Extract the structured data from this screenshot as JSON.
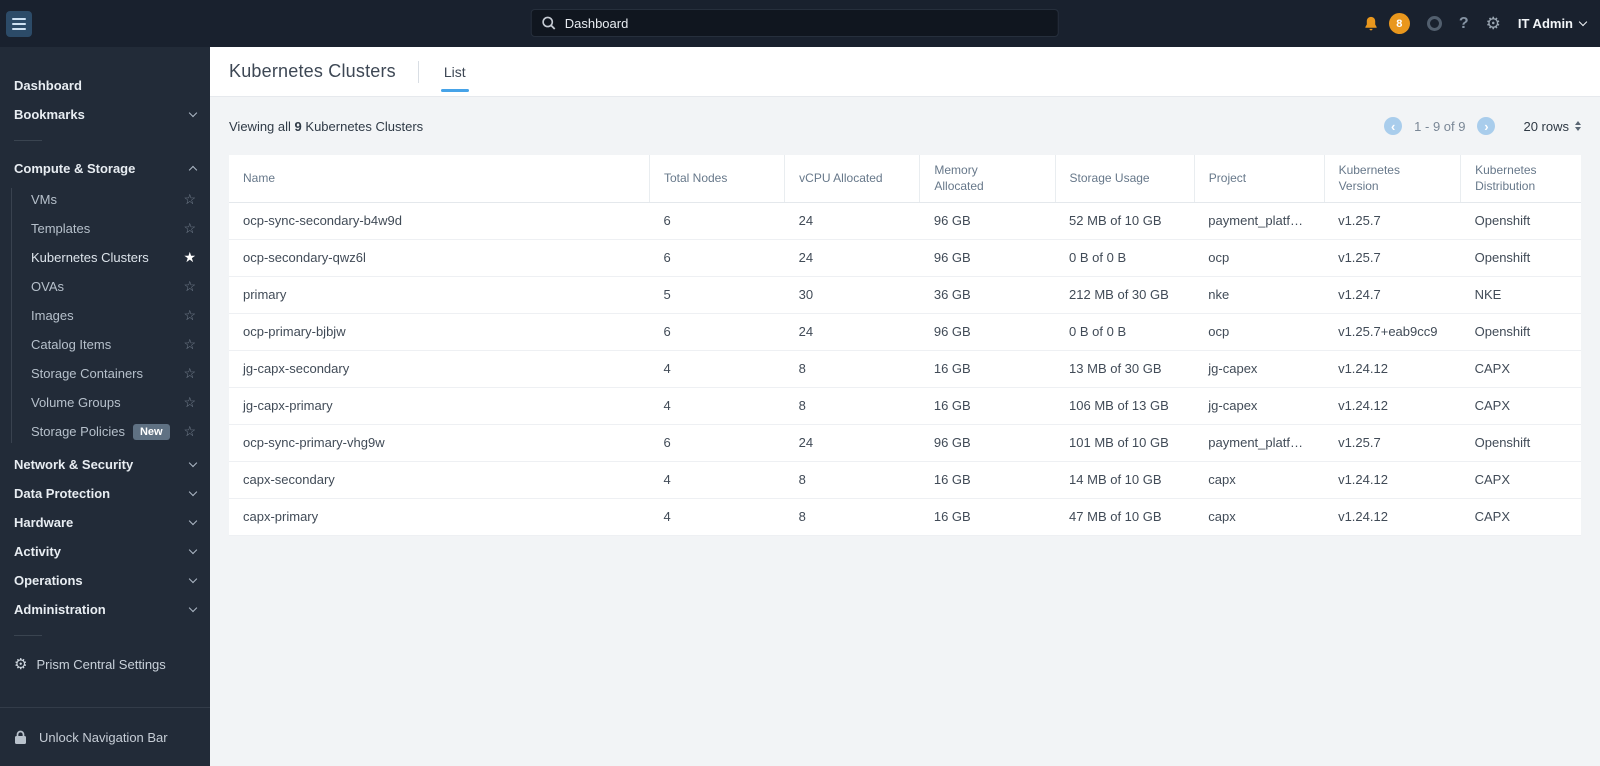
{
  "colors": {
    "accent": "#46a3e8",
    "notification": "#e9971d",
    "topbar": "#19212e",
    "sidebar": "#222b38"
  },
  "topbar": {
    "search": {
      "value": "Dashboard"
    },
    "notification_count": "8",
    "help_label": "?",
    "user_label": "IT Admin"
  },
  "sidebar": {
    "dashboard_label": "Dashboard",
    "bookmarks_label": "Bookmarks",
    "compute_group_label": "Compute & Storage",
    "compute_items": [
      {
        "label": "VMs",
        "starred": false,
        "badge": ""
      },
      {
        "label": "Templates",
        "starred": false,
        "badge": ""
      },
      {
        "label": "Kubernetes Clusters",
        "starred": true,
        "badge": "",
        "active": true
      },
      {
        "label": "OVAs",
        "starred": false,
        "badge": ""
      },
      {
        "label": "Images",
        "starred": false,
        "badge": ""
      },
      {
        "label": "Catalog Items",
        "starred": false,
        "badge": ""
      },
      {
        "label": "Storage Containers",
        "starred": false,
        "badge": ""
      },
      {
        "label": "Volume Groups",
        "starred": false,
        "badge": ""
      },
      {
        "label": "Storage Policies",
        "starred": false,
        "badge": "New"
      }
    ],
    "sections": [
      {
        "label": "Network & Security"
      },
      {
        "label": "Data Protection"
      },
      {
        "label": "Hardware"
      },
      {
        "label": "Activity"
      },
      {
        "label": "Operations"
      },
      {
        "label": "Administration"
      }
    ],
    "settings_label": "Prism Central Settings",
    "unlock_label": "Unlock Navigation Bar"
  },
  "main": {
    "title": "Kubernetes Clusters",
    "tab_label": "List",
    "viewing_prefix": "Viewing all",
    "viewing_count": "9",
    "viewing_suffix": "Kubernetes Clusters",
    "pagination": {
      "range": "1 - 9 of 9",
      "rows_label": "20 rows"
    },
    "table": {
      "columns": [
        "Name",
        "Total Nodes",
        "vCPU Allocated",
        "Memory\nAllocated",
        "Storage Usage",
        "Project",
        "Kubernetes\nVersion",
        "Kubernetes\nDistribution"
      ],
      "rows": [
        {
          "name": "ocp-sync-secondary-b4w9d",
          "nodes": "6",
          "vcpu": "24",
          "memory": "96 GB",
          "storage": "52 MB of 10 GB",
          "project": "payment_platform",
          "version": "v1.25.7",
          "distribution": "Openshift"
        },
        {
          "name": "ocp-secondary-qwz6l",
          "nodes": "6",
          "vcpu": "24",
          "memory": "96 GB",
          "storage": "0 B of 0 B",
          "project": "ocp",
          "version": "v1.25.7",
          "distribution": "Openshift"
        },
        {
          "name": "primary",
          "nodes": "5",
          "vcpu": "30",
          "memory": "36 GB",
          "storage": "212 MB of 30 GB",
          "project": "nke",
          "version": "v1.24.7",
          "distribution": "NKE"
        },
        {
          "name": "ocp-primary-bjbjw",
          "nodes": "6",
          "vcpu": "24",
          "memory": "96 GB",
          "storage": "0 B of 0 B",
          "project": "ocp",
          "version": "v1.25.7+eab9cc9",
          "distribution": "Openshift"
        },
        {
          "name": "jg-capx-secondary",
          "nodes": "4",
          "vcpu": "8",
          "memory": "16 GB",
          "storage": "13 MB of 30 GB",
          "project": "jg-capex",
          "version": "v1.24.12",
          "distribution": "CAPX"
        },
        {
          "name": "jg-capx-primary",
          "nodes": "4",
          "vcpu": "8",
          "memory": "16 GB",
          "storage": "106 MB of 13 GB",
          "project": "jg-capex",
          "version": "v1.24.12",
          "distribution": "CAPX"
        },
        {
          "name": "ocp-sync-primary-vhg9w",
          "nodes": "6",
          "vcpu": "24",
          "memory": "96 GB",
          "storage": "101 MB of 10 GB",
          "project": "payment_platform",
          "version": "v1.25.7",
          "distribution": "Openshift"
        },
        {
          "name": "capx-secondary",
          "nodes": "4",
          "vcpu": "8",
          "memory": "16 GB",
          "storage": "14 MB of 10 GB",
          "project": "capx",
          "version": "v1.24.12",
          "distribution": "CAPX"
        },
        {
          "name": "capx-primary",
          "nodes": "4",
          "vcpu": "8",
          "memory": "16 GB",
          "storage": "47 MB of 10 GB",
          "project": "capx",
          "version": "v1.24.12",
          "distribution": "CAPX"
        }
      ]
    }
  }
}
